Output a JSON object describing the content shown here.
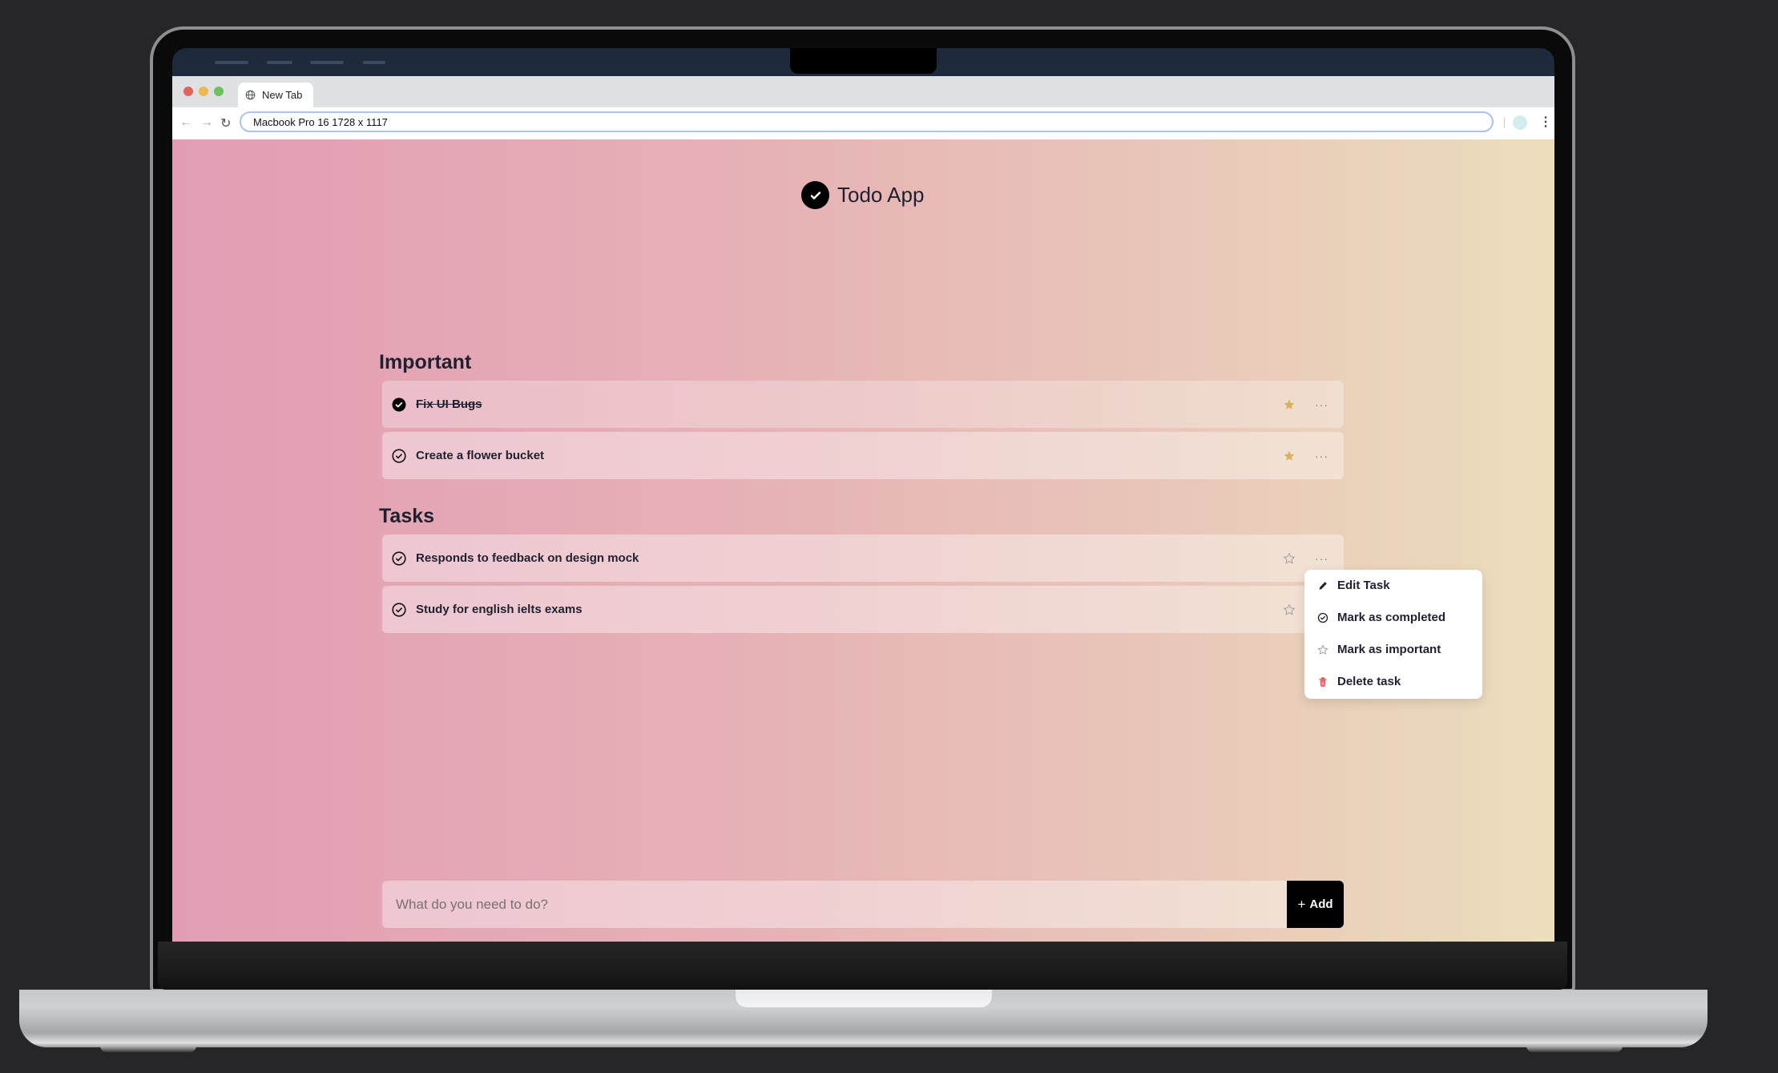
{
  "browser": {
    "tab_title": "New Tab",
    "address": "Macbook Pro 16  1728 x 1117",
    "traffic_lights": [
      "#e0645a",
      "#ecb94f",
      "#6ac25a"
    ]
  },
  "app": {
    "title": "Todo App",
    "gradient": [
      "#e29db4",
      "#ecdebd"
    ],
    "sections": [
      {
        "heading": "Important",
        "tasks": [
          {
            "label": "Fix UI Bugs",
            "completed": true,
            "important": true
          },
          {
            "label": "Create a flower bucket",
            "completed": false,
            "important": true
          }
        ]
      },
      {
        "heading": "Tasks",
        "tasks": [
          {
            "label": "Responds to feedback on design mock",
            "completed": false,
            "important": false
          },
          {
            "label": "Study for english ielts exams",
            "completed": false,
            "important": false
          }
        ]
      }
    ],
    "context_menu": {
      "items": [
        {
          "label": "Edit Task",
          "icon": "pencil-icon"
        },
        {
          "label": "Mark as completed",
          "icon": "check-circle-icon"
        },
        {
          "label": "Mark as important",
          "icon": "star-outline-icon"
        },
        {
          "label": "Delete task",
          "icon": "trash-icon",
          "color": "#e5484d"
        }
      ]
    },
    "input": {
      "placeholder": "What do you need to do?",
      "value": ""
    },
    "add_button": {
      "icon": "+",
      "label": "Add"
    },
    "star_color": "#d9b160"
  }
}
